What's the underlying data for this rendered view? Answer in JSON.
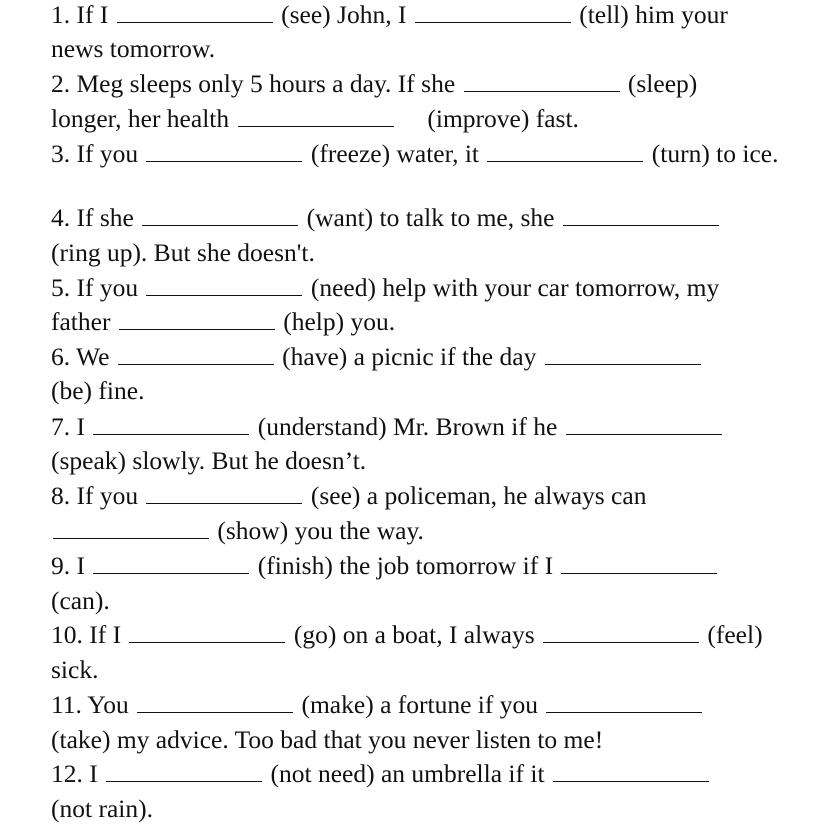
{
  "exercises": [
    {
      "number": "1.",
      "lines": [
        [
          "If I ",
          "BLANK",
          " (see) John, I ",
          "BLANK",
          " (tell) him your"
        ],
        [
          "news tomorrow."
        ]
      ]
    },
    {
      "number": "2.",
      "lines": [
        [
          "Meg sleeps only 5 hours a day. If she ",
          "BLANK",
          " (sleep)"
        ],
        [
          "longer, her health ",
          "BLANK",
          "     (improve) fast."
        ]
      ]
    },
    {
      "number": "3.",
      "lines": [
        [
          "If you ",
          "BLANK",
          " (freeze) water, it ",
          "BLANK",
          " (turn) to ice."
        ]
      ]
    },
    {
      "number": "4.",
      "lines": [
        [
          "If she ",
          "BLANK",
          " (want) to talk to me, she ",
          "BLANK"
        ],
        [
          "(ring up). But she doesn't."
        ]
      ]
    },
    {
      "number": "5.",
      "lines": [
        [
          "If you ",
          "BLANK",
          " (need) help with your car tomorrow, my"
        ],
        [
          "father ",
          "BLANK",
          " (help) you."
        ]
      ]
    },
    {
      "number": "6.",
      "lines": [
        [
          "We ",
          "BLANK",
          " (have) a picnic if the day ",
          "BLANK"
        ],
        [
          "(be) fine."
        ]
      ]
    },
    {
      "number": "7.",
      "lines": [
        [
          "I ",
          "BLANK",
          " (understand) Mr. Brown if he ",
          "BLANK"
        ],
        [
          "(speak) slowly. But he doesn’t."
        ]
      ]
    },
    {
      "number": "8.",
      "lines": [
        [
          "If you ",
          "BLANK",
          " (see) a policeman, he always can"
        ],
        [
          "BLANK",
          " (show) you the way."
        ]
      ]
    },
    {
      "number": "9.",
      "lines": [
        [
          "I ",
          "BLANK",
          " (finish) the job tomorrow if I ",
          "BLANK"
        ],
        [
          "(can)."
        ]
      ]
    },
    {
      "number": "10.",
      "lines": [
        [
          "If I ",
          "BLANK",
          " (go) on a boat, I always ",
          "BLANK",
          " (feel)"
        ],
        [
          "sick."
        ]
      ]
    },
    {
      "number": "11.",
      "lines": [
        [
          "You ",
          "BLANK",
          " (make) a fortune if you ",
          "BLANK"
        ],
        [
          "(take) my advice. Too bad that you never listen to me!"
        ]
      ]
    },
    {
      "number": "12.",
      "lines": [
        [
          "I ",
          "BLANK",
          " (not need) an umbrella if it ",
          "BLANK"
        ],
        [
          "(not rain)."
        ]
      ]
    }
  ]
}
